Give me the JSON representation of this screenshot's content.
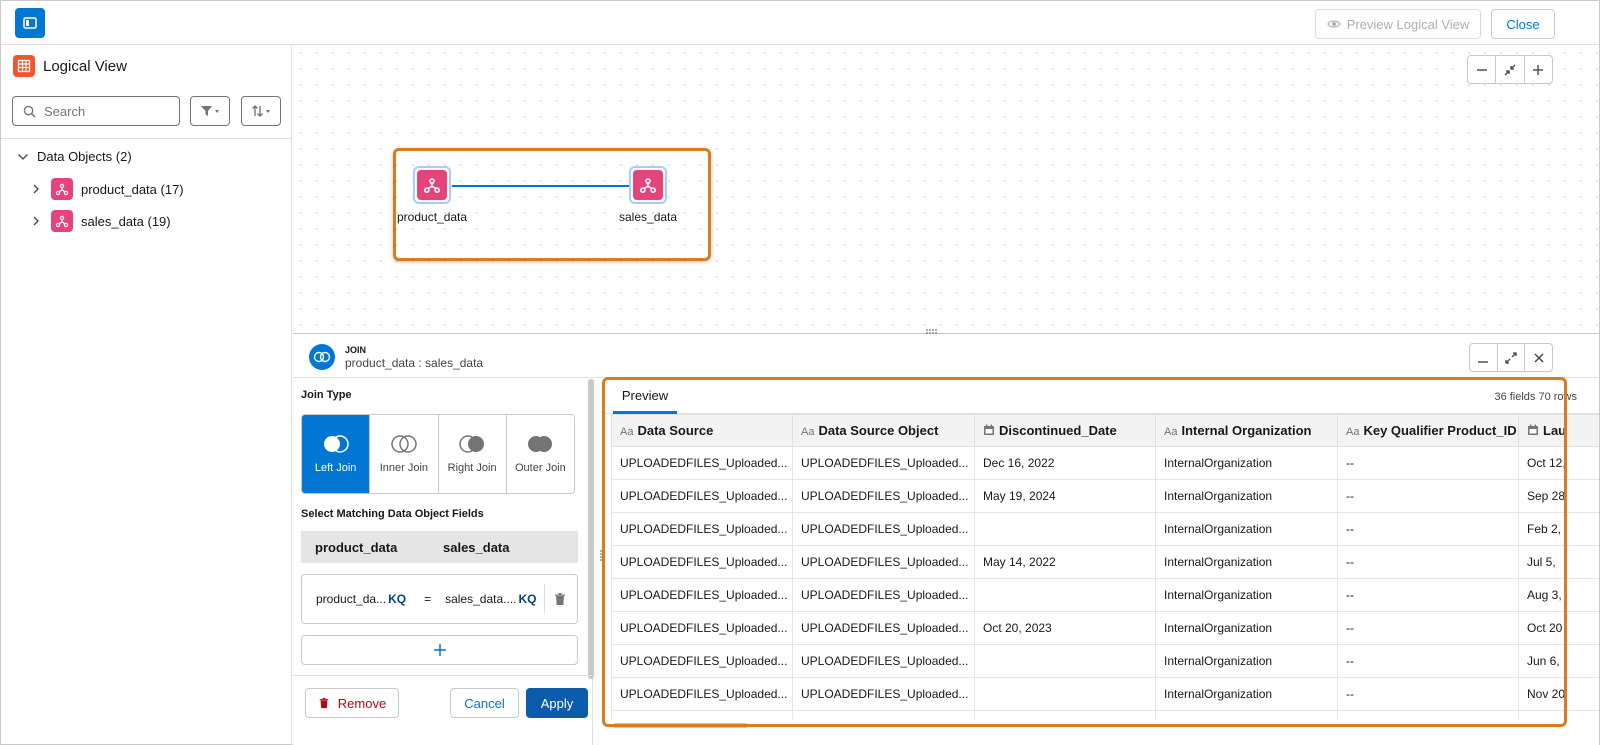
{
  "topbar": {
    "preview_label": "Preview Logical View",
    "close_label": "Close"
  },
  "left_panel": {
    "title": "Logical View",
    "search_placeholder": "Search",
    "tree": {
      "root_label": "Data Objects (2)",
      "items": [
        {
          "label": "product_data (17)"
        },
        {
          "label": "sales_data (19)"
        }
      ]
    }
  },
  "canvas": {
    "nodes": [
      {
        "label": "product_data"
      },
      {
        "label": "sales_data"
      }
    ]
  },
  "join": {
    "kind": "JOIN",
    "name": "product_data : sales_data",
    "join_type_title": "Join Type",
    "join_types": [
      "Left Join",
      "Inner Join",
      "Right Join",
      "Outer Join"
    ],
    "selected_join_type": "Left Join",
    "match_title": "Select Matching Data Object Fields",
    "match_head": [
      "product_data",
      "sales_data"
    ],
    "match_row": {
      "left": "product_da...",
      "left_tag": "KQ",
      "op": "=",
      "right": "sales_data....",
      "right_tag": "KQ"
    },
    "remove_label": "Remove",
    "cancel_label": "Cancel",
    "apply_label": "Apply"
  },
  "preview": {
    "tab_label": "Preview",
    "counts": "36 fields 70 rows",
    "columns": [
      {
        "type": "text",
        "label": "Data Source"
      },
      {
        "type": "text",
        "label": "Data Source Object"
      },
      {
        "type": "date",
        "label": "Discontinued_Date"
      },
      {
        "type": "text",
        "label": "Internal Organization"
      },
      {
        "type": "text",
        "label": "Key Qualifier Product_ID"
      },
      {
        "type": "date",
        "label": "Lau"
      }
    ],
    "rows": [
      [
        "UPLOADEDFILES_Uploaded...",
        "UPLOADEDFILES_Uploaded...",
        "Dec 16, 2022",
        "InternalOrganization",
        "--",
        "Oct 12,"
      ],
      [
        "UPLOADEDFILES_Uploaded...",
        "UPLOADEDFILES_Uploaded...",
        "May 19, 2024",
        "InternalOrganization",
        "--",
        "Sep 28"
      ],
      [
        "UPLOADEDFILES_Uploaded...",
        "UPLOADEDFILES_Uploaded...",
        "",
        "InternalOrganization",
        "--",
        "Feb 2,"
      ],
      [
        "UPLOADEDFILES_Uploaded...",
        "UPLOADEDFILES_Uploaded...",
        "May 14, 2022",
        "InternalOrganization",
        "--",
        "Jul 5,"
      ],
      [
        "UPLOADEDFILES_Uploaded...",
        "UPLOADEDFILES_Uploaded...",
        "",
        "InternalOrganization",
        "--",
        "Aug 3,"
      ],
      [
        "UPLOADEDFILES_Uploaded...",
        "UPLOADEDFILES_Uploaded...",
        "Oct 20, 2023",
        "InternalOrganization",
        "--",
        "Oct 20"
      ],
      [
        "UPLOADEDFILES_Uploaded...",
        "UPLOADEDFILES_Uploaded...",
        "",
        "InternalOrganization",
        "--",
        "Jun 6,"
      ],
      [
        "UPLOADEDFILES_Uploaded...",
        "UPLOADEDFILES_Uploaded...",
        "",
        "InternalOrganization",
        "--",
        "Nov 20"
      ],
      [
        "",
        "",
        "",
        "",
        "",
        ""
      ]
    ]
  },
  "colors": {
    "brand_blue": "#0176d3",
    "object_pink": "#e3447b",
    "highlight_orange": "#d97b1f",
    "remove_red": "#ba0517"
  }
}
